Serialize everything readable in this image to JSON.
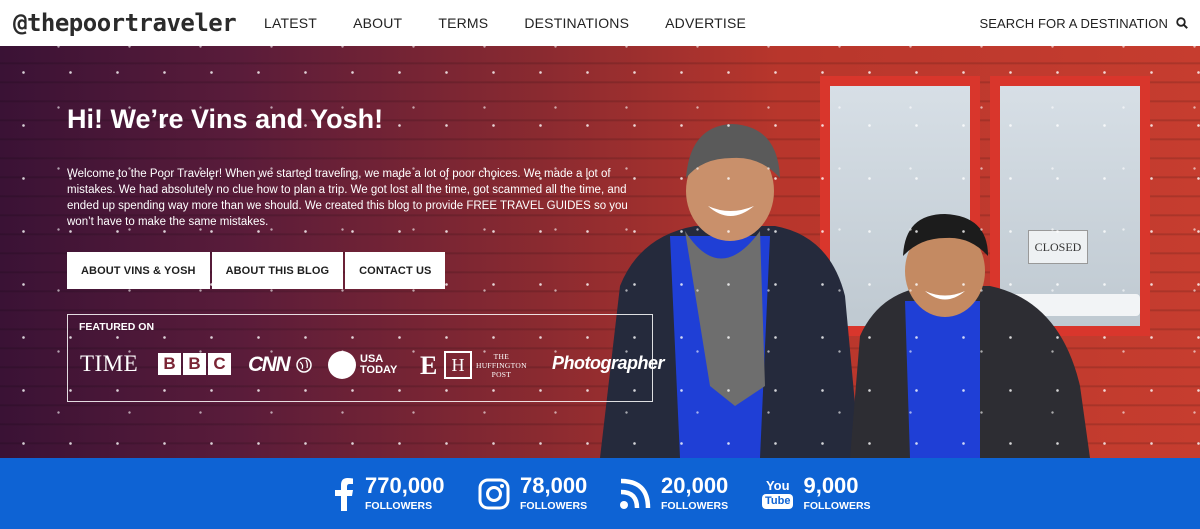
{
  "brand": {
    "logo_text": "@thepoortraveler"
  },
  "nav": {
    "items": [
      {
        "label": "LATEST"
      },
      {
        "label": "ABOUT"
      },
      {
        "label": "TERMS"
      },
      {
        "label": "DESTINATIONS"
      },
      {
        "label": "ADVERTISE"
      }
    ],
    "search_label": "SEARCH FOR A DESTINATION",
    "search_icon": "search-icon"
  },
  "hero": {
    "title": "Hi! We’re Vins and Yosh!",
    "intro": "Welcome to the Poor Traveler! When we started traveling, we made a lot of poor choices. We made a lot of mistakes. We had absolutely no clue how to plan a trip. We got lost all the time, got scammed all the time, and ended up spending way more than we should. We created this blog to provide FREE TRAVEL GUIDES so you won’t have to make the same mistakes.",
    "buttons": [
      {
        "label": "ABOUT VINS & YOSH"
      },
      {
        "label": "ABOUT THIS BLOG"
      },
      {
        "label": "CONTACT US"
      }
    ],
    "sign_text": "CLOSED"
  },
  "featured": {
    "label": "FEATURED ON",
    "logos": {
      "time": "TIME",
      "bbc": [
        "B",
        "B",
        "C"
      ],
      "cnn": "CNN",
      "usa_today": [
        "USA",
        "TODAY"
      ],
      "esquire": "E",
      "huffington_mark": "H",
      "huffington": [
        "THE",
        "HUFFINGTON",
        "POST"
      ],
      "photographer": "Photographer"
    }
  },
  "social": [
    {
      "network": "facebook",
      "icon": "facebook-icon",
      "count": "770,000",
      "label": "FOLLOWERS"
    },
    {
      "network": "instagram",
      "icon": "instagram-icon",
      "count": "78,000",
      "label": "FOLLOWERS"
    },
    {
      "network": "rss",
      "icon": "rss-icon",
      "count": "20,000",
      "label": "FOLLOWERS"
    },
    {
      "network": "youtube",
      "icon": "youtube-icon",
      "icon_text": [
        "You",
        "Tube"
      ],
      "count": "9,000",
      "label": "FOLLOWERS"
    }
  ],
  "colors": {
    "social_bar": "#0e63d4",
    "hero_wall": "#c63d2f",
    "hero_overlay": "#3a1235"
  }
}
